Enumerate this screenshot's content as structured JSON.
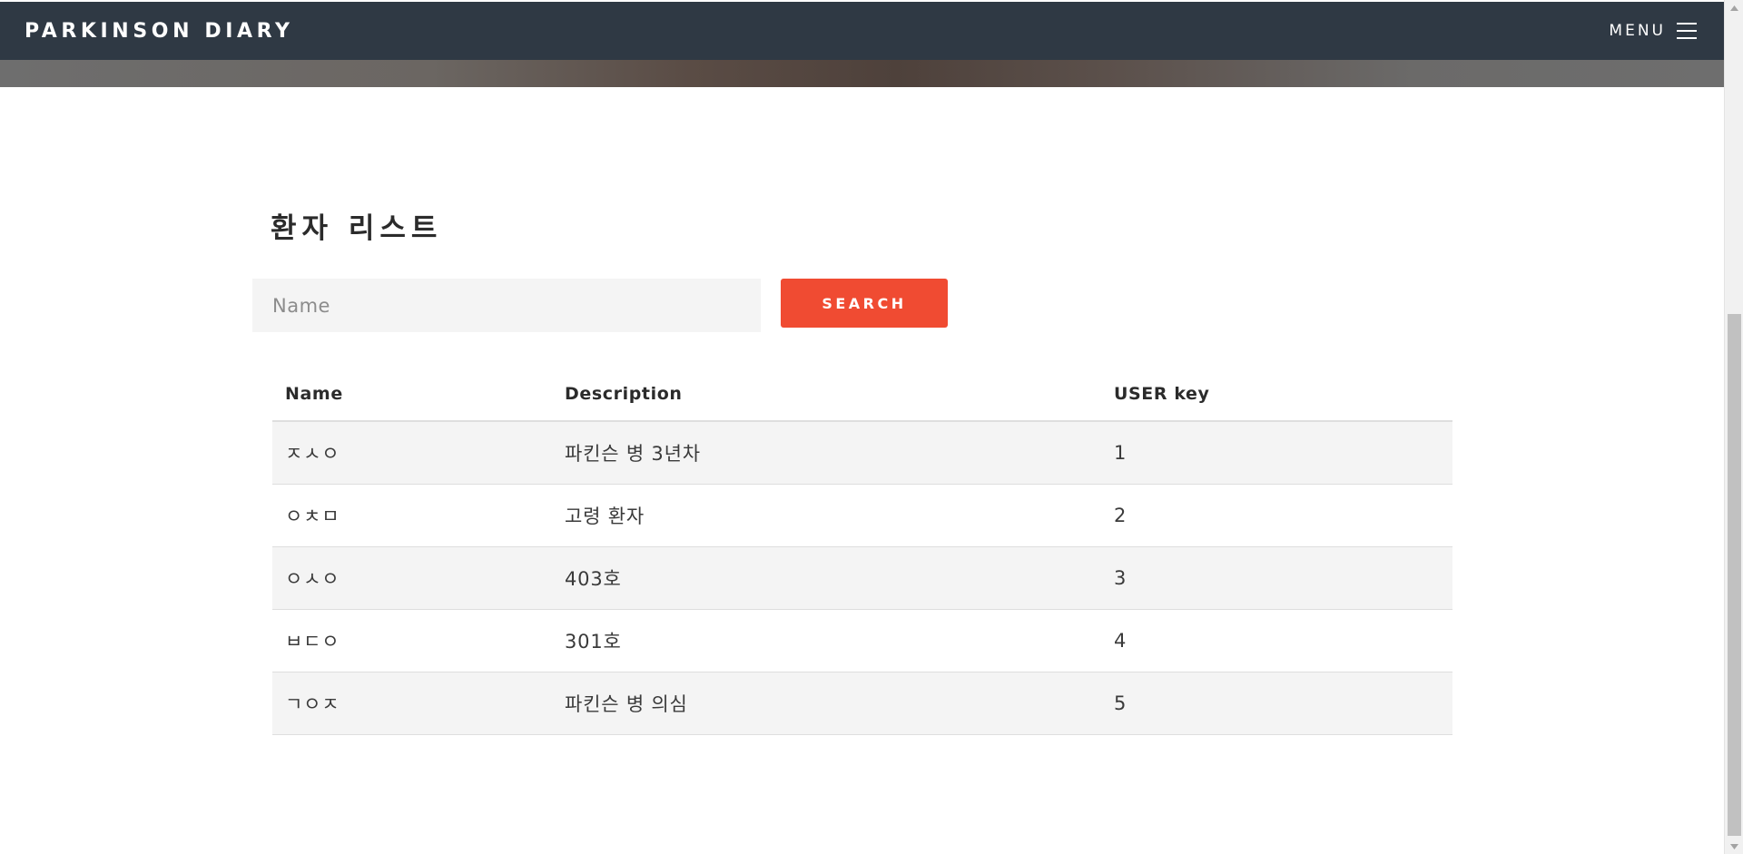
{
  "header": {
    "brand": "PARKINSON DIARY",
    "menu_label": "MENU"
  },
  "section": {
    "title": "환자 리스트"
  },
  "search": {
    "placeholder": "Name",
    "value": "",
    "button_label": "SEARCH"
  },
  "table": {
    "columns": [
      "Name",
      "Description",
      "USER key"
    ],
    "rows": [
      {
        "name": "ㅈㅅㅇ",
        "description": "파킨슨 병 3년차",
        "user_key": "1"
      },
      {
        "name": "ㅇㅊㅁ",
        "description": "고령 환자",
        "user_key": "2"
      },
      {
        "name": "ㅇㅅㅇ",
        "description": "403호",
        "user_key": "3"
      },
      {
        "name": "ㅂㄷㅇ",
        "description": "301호",
        "user_key": "4"
      },
      {
        "name": "ㄱㅇㅈ",
        "description": "파킨슨 병 의심",
        "user_key": "5"
      }
    ]
  },
  "icons": {
    "menu": "hamburger-menu-icon",
    "scroll_up": "scroll-up-arrow-icon",
    "scroll_down": "scroll-down-arrow-icon"
  },
  "colors": {
    "navbar": "#2f3944",
    "accent": "#f04b32",
    "row_stripe": "#f4f4f4"
  }
}
